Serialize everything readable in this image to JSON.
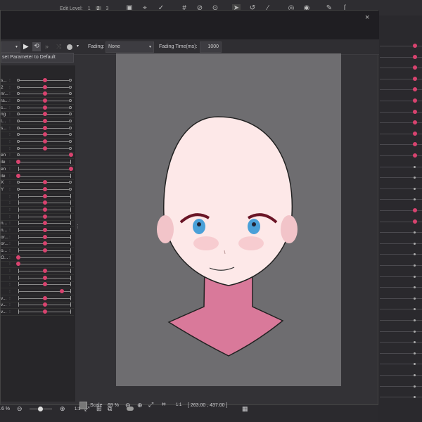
{
  "topbar": {
    "edit_level_label": "Edit Level:",
    "levels": [
      "1",
      "2",
      "3"
    ],
    "active_level": "2"
  },
  "dialog": {
    "close_label": "×",
    "fading_label": "Fading:",
    "fading_value": "None",
    "fading_time_label": "Fading Time(ms):",
    "fading_time_value": "1000",
    "reset_label": "set Parameter to Default"
  },
  "params": [
    {
      "label": "s...",
      "value": 0.5,
      "style": "circle"
    },
    {
      "label": "2",
      "value": 0.5,
      "style": "circle"
    },
    {
      "label": "nr...",
      "value": 0.5,
      "style": "circle"
    },
    {
      "label": "ra...",
      "value": 0.5,
      "style": "circle"
    },
    {
      "label": "c...",
      "value": 0.5,
      "style": "circle"
    },
    {
      "label": "ng",
      "value": 0.5,
      "style": "circle"
    },
    {
      "label": "t...",
      "value": 0.5,
      "style": "circle"
    },
    {
      "label": "s...",
      "value": 0.5,
      "style": "circle"
    },
    {
      "label": "",
      "value": 0.5,
      "style": "circle"
    },
    {
      "label": "",
      "value": 0.5,
      "style": "circle"
    },
    {
      "label": "",
      "value": 0.5,
      "style": "circle"
    },
    {
      "label": "en",
      "value": 1,
      "style": "circle"
    },
    {
      "label": "ile",
      "value": 0,
      "style": "bar"
    },
    {
      "label": "en",
      "value": 1,
      "style": "bar"
    },
    {
      "label": "ile",
      "value": 0,
      "style": "bar"
    },
    {
      "label": "X",
      "value": 0.5,
      "style": "circle"
    },
    {
      "label": "Y",
      "value": 0.5,
      "style": "circle"
    },
    {
      "label": "",
      "value": 0.5,
      "style": "bar"
    },
    {
      "label": "",
      "value": 0.5,
      "style": "bar"
    },
    {
      "label": "",
      "value": 0.5,
      "style": "bar"
    },
    {
      "label": "",
      "value": 0.5,
      "style": "bar"
    },
    {
      "label": "n...",
      "value": 0.5,
      "style": "bar"
    },
    {
      "label": "n...",
      "value": 0.5,
      "style": "bar"
    },
    {
      "label": "or...",
      "value": 0.5,
      "style": "bar"
    },
    {
      "label": "or...",
      "value": 0.5,
      "style": "bar"
    },
    {
      "label": "o...",
      "value": 0.5,
      "style": "bar"
    },
    {
      "label": "O...",
      "value": 0,
      "style": "bar"
    },
    {
      "label": "",
      "value": 0,
      "style": "bar"
    },
    {
      "label": "",
      "value": 0.5,
      "style": "bar"
    },
    {
      "label": "",
      "value": 0.5,
      "style": "bar"
    },
    {
      "label": "",
      "value": 0.5,
      "style": "bar"
    },
    {
      "label": "",
      "value": 0.82,
      "style": "bar"
    },
    {
      "label": "v...",
      "value": 0.5,
      "style": "bar"
    },
    {
      "label": "v...",
      "value": 0.5,
      "style": "bar"
    },
    {
      "label": "v...",
      "value": 0.5,
      "style": "bar"
    }
  ],
  "status": {
    "scale_label": "Scale",
    "scale_value": "69 %",
    "ratio_label": "1:1",
    "coords": "[ 263.00 , 437.00 ]"
  },
  "bottom": {
    "zoom_value": ".6 %",
    "ratio_label": "1:1"
  },
  "colors": {
    "accent": "#d9436f",
    "canvas": "#6e6d70"
  }
}
